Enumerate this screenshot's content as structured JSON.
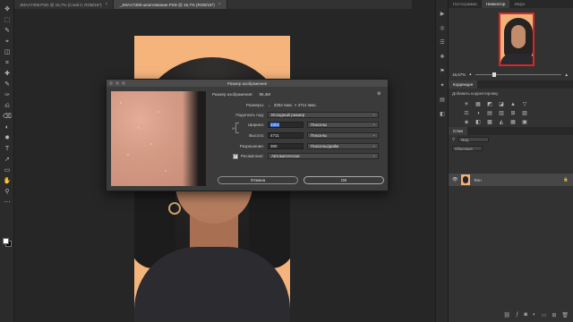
{
  "tabs": [
    {
      "label": "JMAA7308.PSD @ 16,7% (Слой 0, RGB/16*)",
      "active": false
    },
    {
      "label": "_JMAA7308-шпатлевание.PSD @ 16,7% (RGB/16*)",
      "active": true
    }
  ],
  "tools": [
    "✥",
    "⬚",
    "✎",
    "⌖",
    "◫",
    "⌗",
    "✚",
    "✎",
    "✑",
    "⎌",
    "⌫",
    "◐",
    "✹",
    "T",
    "➚",
    "▭",
    "✋",
    "⚲",
    "⋯"
  ],
  "dialog": {
    "title": "Размер изображения",
    "image_size_label": "Размер изображения:",
    "image_size_value": "95,4М",
    "dimensions_label": "Размеры:",
    "dimensions_value": "3302 пикс. × 4711 пикс.",
    "fit_label": "Подогнать под:",
    "fit_value": "Исходный размер",
    "width_label": "Ширина:",
    "width_value": "3302",
    "width_unit": "Пикселы",
    "height_label": "Высота:",
    "height_value": "4711",
    "height_unit": "Пикселы",
    "resolution_label": "Разрешение:",
    "resolution_value": "300",
    "resolution_unit": "Пикселы/дюйм",
    "resample_label": "Ресамплинг:",
    "resample_value": "Автоматически",
    "cancel": "Отмена",
    "ok": "ОК"
  },
  "panels": {
    "tabs": [
      {
        "label": "Гистограмма",
        "active": false
      },
      {
        "label": "Навигатор",
        "active": true
      },
      {
        "label": "Инфо",
        "active": false
      }
    ],
    "zoom": "16,67%",
    "adjust_tabs": [
      {
        "label": "Коррекция",
        "active": true
      }
    ],
    "adjust_hint": "Добавить корректировку",
    "adjust_icons": [
      "☀",
      "▦",
      "◩",
      "◪",
      "▲",
      "▽",
      "⚖",
      "◑",
      "▤",
      "▥",
      "⊞",
      "▨",
      "◈",
      "◧",
      "▩",
      "◭",
      "▦",
      "▣"
    ],
    "layers_tab": "Слои",
    "layer_kind": "Вид",
    "layer_mode": "Обычные",
    "layer_name": "Фон"
  },
  "icons_col": [
    "▶",
    "◎",
    "☰",
    "❖",
    "⚑",
    "✦",
    "▤",
    "◧"
  ]
}
